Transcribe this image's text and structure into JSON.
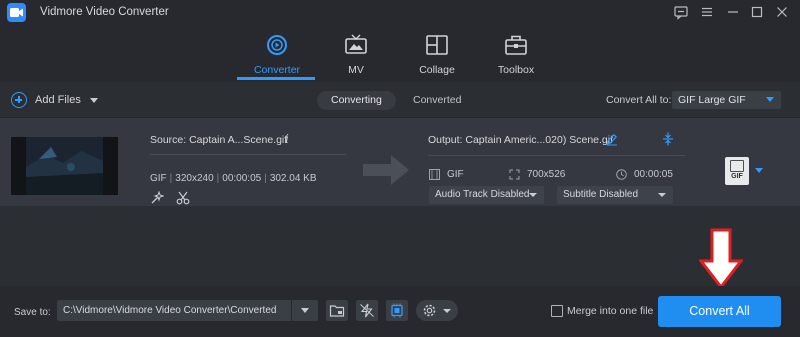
{
  "app": {
    "title": "Vidmore Video Converter"
  },
  "nav": {
    "tabs": [
      {
        "label": "Converter",
        "active": true,
        "icon": "converter-icon"
      },
      {
        "label": "MV",
        "active": false,
        "icon": "mv-icon"
      },
      {
        "label": "Collage",
        "active": false,
        "icon": "collage-icon"
      },
      {
        "label": "Toolbox",
        "active": false,
        "icon": "toolbox-icon"
      }
    ]
  },
  "toolbar": {
    "add_files": "Add Files",
    "segments": [
      "Converting",
      "Converted"
    ],
    "active_segment": "Converting",
    "convert_all_to_label": "Convert All to:",
    "convert_all_to_value": "GIF Large GIF"
  },
  "file": {
    "source": "Source: Captain A...Scene.gif",
    "meta": {
      "format": "GIF",
      "resolution": "320x240",
      "duration": "00:00:05",
      "size": "302.04 KB"
    },
    "output": "Output: Captain Americ...020) Scene.gif",
    "output_format": "GIF",
    "output_resolution": "700x526",
    "output_duration": "00:00:05",
    "audio_track": "Audio Track Disabled",
    "subtitle": "Subtitle Disabled",
    "format_badge": "GIF"
  },
  "bottom": {
    "save_to_label": "Save to:",
    "save_path": "C:\\Vidmore\\Vidmore Video Converter\\Converted",
    "merge_label": "Merge into one file",
    "merge_checked": false,
    "convert_all": "Convert All"
  },
  "colors": {
    "accent": "#2f9bff",
    "convert_button": "#1f8ef0",
    "annotation_arrow": "#e02020",
    "background": "#2b2e33"
  }
}
